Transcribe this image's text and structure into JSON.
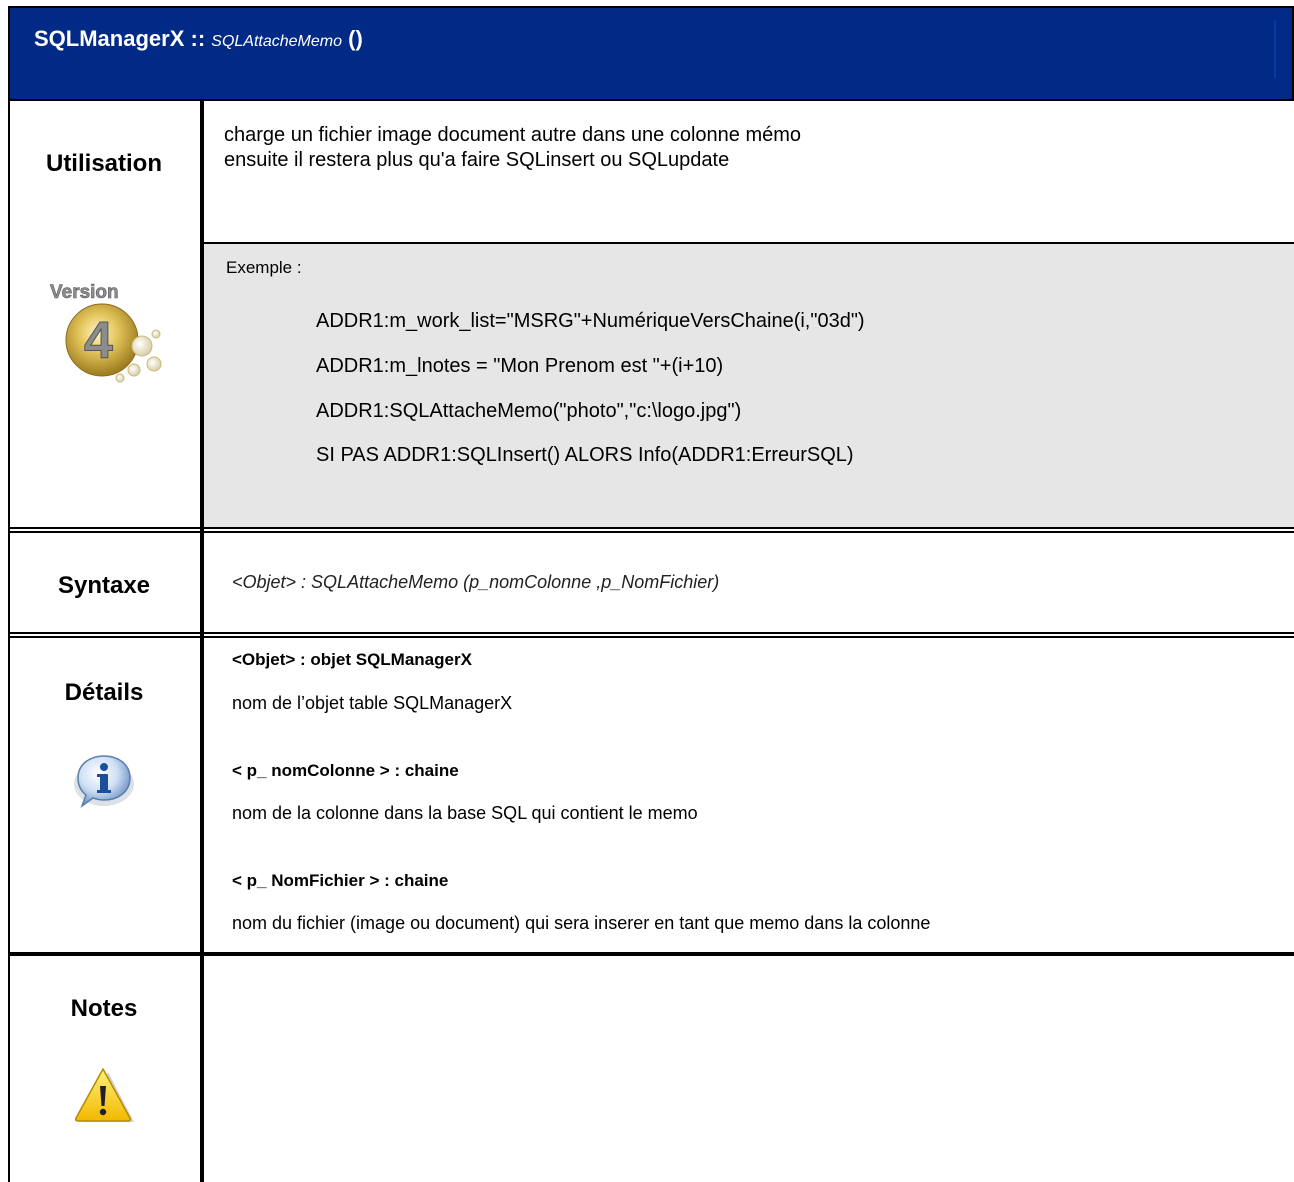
{
  "header": {
    "class_name": "SQLManagerX",
    "separator": " :: ",
    "method_name": "SQLAttacheMemo",
    "parens": " ()"
  },
  "sections": {
    "utilisation": {
      "label": "Utilisation",
      "lines": [
        "charge un fichier image document autre dans une colonne mémo",
        "ensuite il restera plus qu'a faire SQLinsert ou SQLupdate"
      ],
      "badge_icon": "version-4-badge-icon",
      "badge_text": "Version",
      "badge_number": "4",
      "example_label": "Exemple :",
      "example_code": [
        "ADDR1:m_work_list=\"MSRG\"+NumériqueVersChaine(i,\"03d\")",
        "ADDR1:m_lnotes = \"Mon Prenom est \"+(i+10)",
        "ADDR1:SQLAttacheMemo(\"photo\",\"c:\\logo.jpg\")",
        "SI PAS ADDR1:SQLInsert() ALORS Info(ADDR1:ErreurSQL)"
      ]
    },
    "syntaxe": {
      "label": "Syntaxe",
      "text": "<Objet> : SQLAttacheMemo (p_nomColonne ,p_NomFichier)"
    },
    "details": {
      "label": "Détails",
      "icon": "info-icon",
      "params": [
        {
          "name": "<Objet> : objet SQLManagerX",
          "desc": "nom de l’objet table SQLManagerX"
        },
        {
          "name": "< p_ nomColonne > : chaine",
          "desc": "nom de la colonne dans la base SQL qui contient le memo"
        },
        {
          "name": "< p_ NomFichier >  : chaine",
          "desc": "nom du fichier (image ou document) qui sera inserer en tant que memo dans la colonne"
        }
      ]
    },
    "notes": {
      "label": "Notes",
      "icon": "warning-icon"
    }
  },
  "colors": {
    "header_bg": "#002a86",
    "example_bg": "#e6e6e6"
  }
}
